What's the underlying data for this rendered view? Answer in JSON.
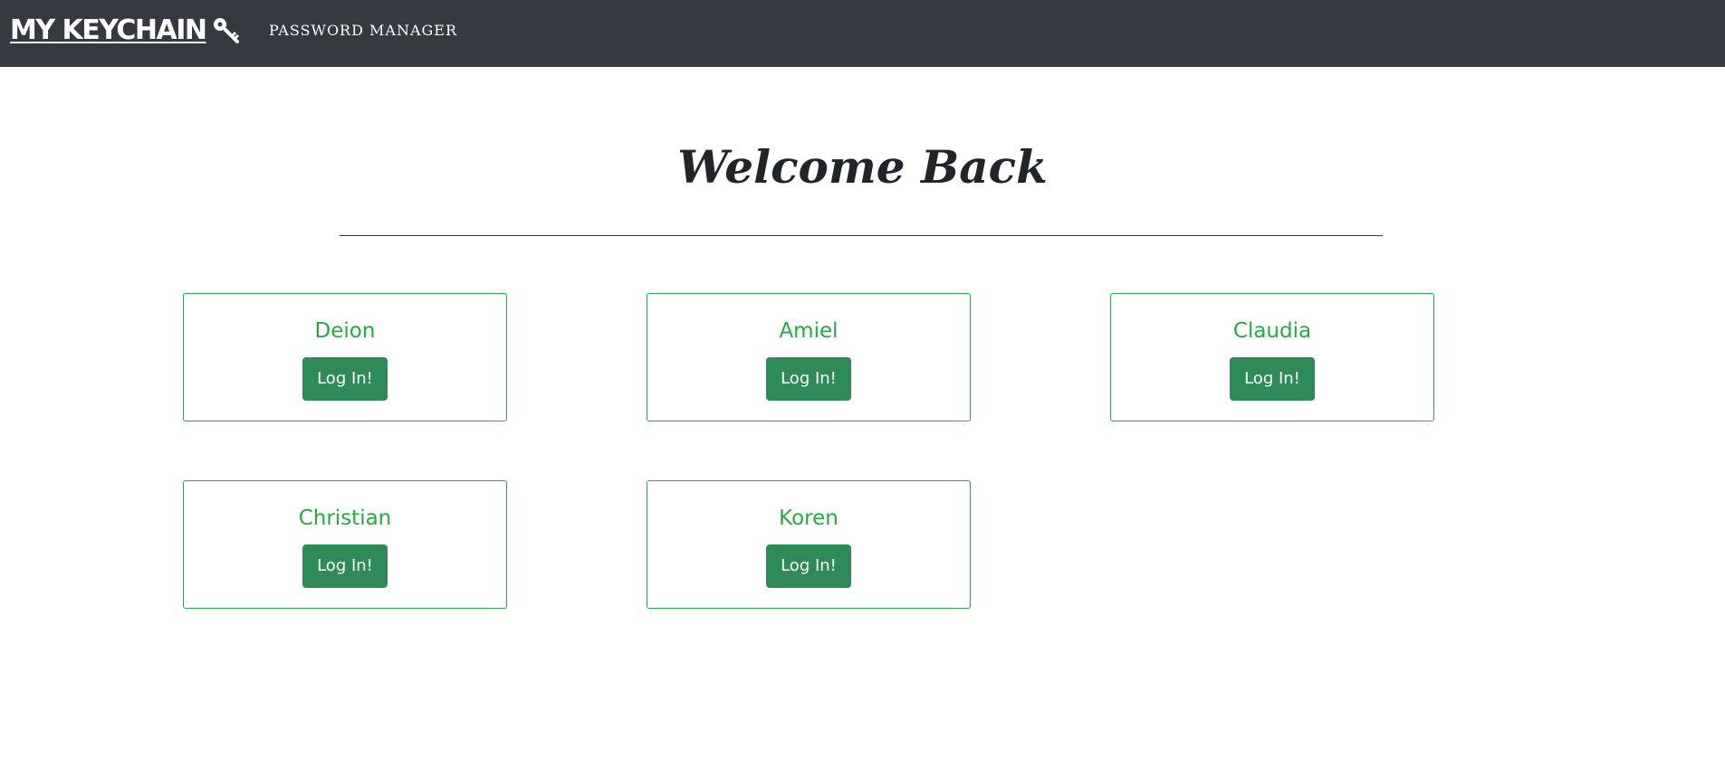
{
  "navbar": {
    "brand": "MY KEYCHAIN",
    "brand_icon": "key-icon",
    "tagline": "PASSWORD MANAGER"
  },
  "main": {
    "heading": "Welcome Back",
    "users": [
      {
        "name": "Deion",
        "button_label": "Log In!"
      },
      {
        "name": "Amiel",
        "button_label": "Log In!"
      },
      {
        "name": "Claudia",
        "button_label": "Log In!"
      },
      {
        "name": "Christian",
        "button_label": "Log In!"
      },
      {
        "name": "Koren",
        "button_label": "Log In!"
      }
    ]
  },
  "colors": {
    "navbar_bg": "#343a40",
    "accent_green": "#28a745",
    "button_green": "#2e8b57",
    "heading_text": "#212529"
  }
}
